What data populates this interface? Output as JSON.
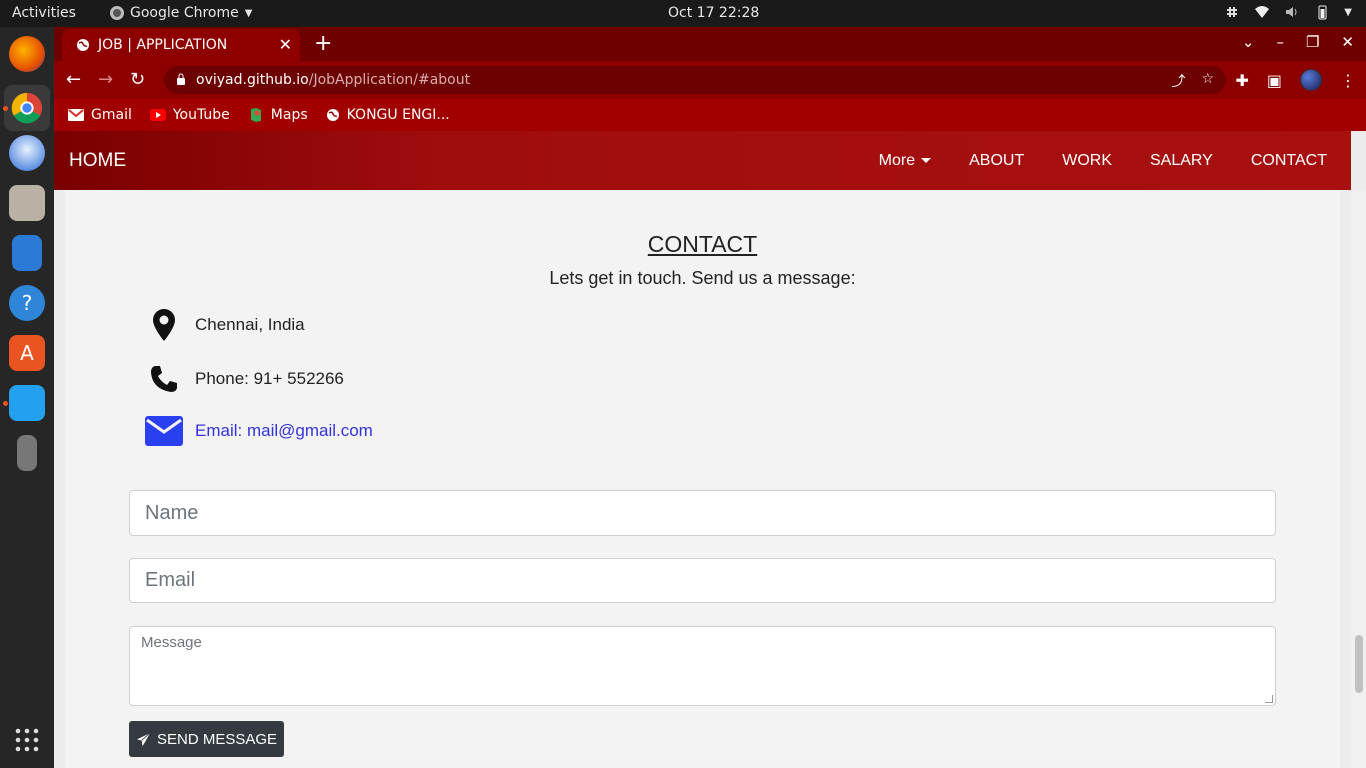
{
  "os": {
    "activities": "Activities",
    "app_name": "Google Chrome",
    "clock": "Oct 17  22:28"
  },
  "browser": {
    "tab_title": "JOB | APPLICATION",
    "url_host": "oviyad.github.io",
    "url_path": "/JobApplication/#about",
    "bookmarks": [
      {
        "label": "Gmail",
        "icon": "gmail-icon"
      },
      {
        "label": "YouTube",
        "icon": "youtube-icon"
      },
      {
        "label": "Maps",
        "icon": "maps-icon"
      },
      {
        "label": "KONGU ENGI...",
        "icon": "globe-icon"
      }
    ]
  },
  "nav": {
    "brand": "HOME",
    "more": "More",
    "about": "ABOUT",
    "work": "WORK",
    "salary": "SALARY",
    "contact": "CONTACT"
  },
  "contact": {
    "title": "CONTACT",
    "subtitle": "Lets get in touch. Send us a message:",
    "location": "Chennai, India",
    "phone": "Phone: 91+ 552266",
    "email": "Email: mail@gmail.com"
  },
  "form": {
    "name_placeholder": "Name",
    "email_placeholder": "Email",
    "message_placeholder": "Message",
    "send_label": "SEND MESSAGE"
  },
  "colors": {
    "navbar": "#a00d0d",
    "tabstrip": "#6e0000",
    "link": "#3333dd",
    "button": "#343a40"
  }
}
